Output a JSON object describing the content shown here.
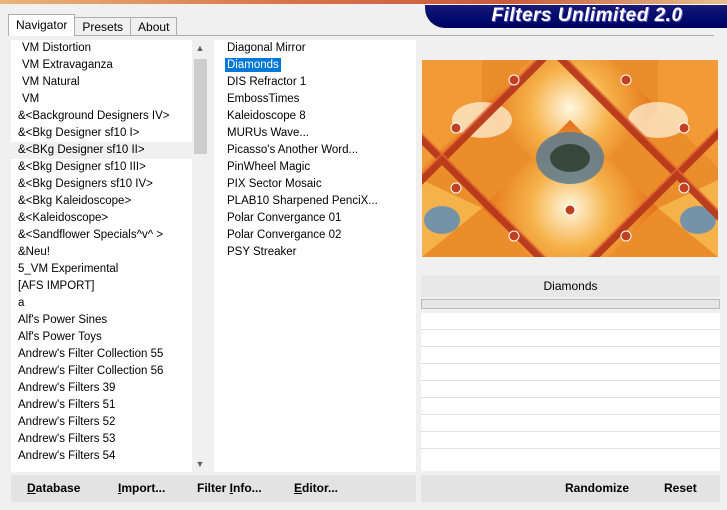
{
  "window": {
    "banner_title": "Filters Unlimited 2.0"
  },
  "tabs": [
    {
      "label": "Navigator",
      "active": true
    },
    {
      "label": "Presets",
      "active": false
    },
    {
      "label": "About",
      "active": false
    }
  ],
  "categories": {
    "selected": "&<BKg Designer sf10 II>",
    "items": [
      "VM Distortion",
      "VM Extravaganza",
      "VM Natural",
      "VM",
      "&<Background Designers IV>",
      "&<Bkg Designer sf10 I>",
      "&<BKg Designer sf10 II>",
      "&<Bkg Designer sf10 III>",
      "&<Bkg Designers sf10 IV>",
      "&<Bkg Kaleidoscope>",
      "&<Kaleidoscope>",
      "&<Sandflower Specials^v^ >",
      "&Neu!",
      "5_VM Experimental",
      "[AFS IMPORT]",
      "a",
      "Alf's Power Sines",
      "Alf's Power Toys",
      "Andrew's Filter Collection 55",
      "Andrew's Filter Collection 56",
      "Andrew's Filters 39",
      "Andrew's Filters 51",
      "Andrew's Filters 52",
      "Andrew's Filters 53",
      "Andrew's Filters 54"
    ]
  },
  "filters": {
    "selected": "Diamonds",
    "items": [
      "Diagonal Mirror",
      "Diamonds",
      "DIS Refractor 1",
      "EmbossTimes",
      "Kaleidoscope 8",
      "MURUs Wave...",
      "Picasso's Another Word...",
      "PinWheel Magic",
      "PIX Sector Mosaic",
      "PLAB10 Sharpened PenciX...",
      "Polar Convergance 01",
      "Polar Convergance 02",
      "PSY Streaker"
    ]
  },
  "preview": {
    "filter_name": "Diamonds",
    "progress": 0
  },
  "buttons": {
    "database": {
      "first": "D",
      "rest": "atabase"
    },
    "import": {
      "first": "I",
      "rest": "mport..."
    },
    "filter_info": {
      "pre": "Filter ",
      "first": "I",
      "rest": "nfo..."
    },
    "editor": {
      "first": "E",
      "rest": "ditor..."
    },
    "randomize": "Randomize",
    "reset": "Reset"
  },
  "colors": {
    "selection": "#0078d7",
    "banner_bg": "#000a6a",
    "window_bg": "#f0f0f0"
  }
}
